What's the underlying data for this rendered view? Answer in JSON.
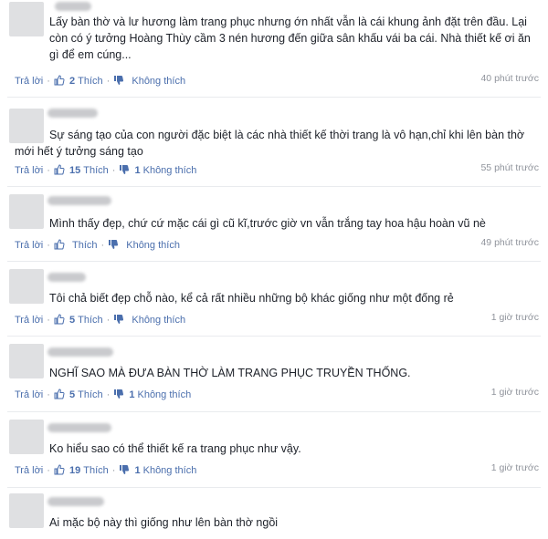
{
  "labels": {
    "reply": "Trả lời",
    "like": "Thích",
    "dislike": "Không thích",
    "separator": "·"
  },
  "colors": {
    "link": "#4b6fad",
    "text": "#1d2129",
    "muted": "#90949c",
    "avatar": "#dfe0e2"
  },
  "icons": {
    "like": "thumbs-up-icon",
    "dislike": "thumbs-down-icon"
  },
  "comments": [
    {
      "text": "Lấy bàn thờ và lư hương làm trang phục nhưng ớn nhất vẫn là cái khung ảnh đặt trên đầu. Lại còn có ý tưởng Hoàng Thùy cầm 3 nén hương đến giữa sân khấu vái ba cái. Nhà thiết kế ơi ăn gì để em cúng...",
      "likes": "2",
      "dislikes": "",
      "time": "40 phút trước"
    },
    {
      "text": "Sự sáng tạo của con người đặc biệt là các nhà thiết kế thời trang là vô hạn,chỉ khi lên bàn thờ mới hết ý tưởng sáng tạo",
      "likes": "15",
      "dislikes": "1",
      "time": "55 phút trước"
    },
    {
      "text": "Mình thấy đẹp, chứ cứ mặc cái gì cũ kĩ,trước giờ vn vẫn trắng tay hoa hậu hoàn vũ nè",
      "likes": "",
      "dislikes": "",
      "time": "49 phút trước"
    },
    {
      "text": "Tôi chả biết đẹp chỗ nào, kể cả rất nhiều những bộ khác giống như một đống rẻ",
      "likes": "5",
      "dislikes": "",
      "time": "1 giờ trước"
    },
    {
      "text": "NGHĨ SAO MÀ ĐƯA BÀN THỜ LÀM TRANG PHỤC TRUYỀN THỐNG.",
      "likes": "5",
      "dislikes": "1",
      "time": "1 giờ trước"
    },
    {
      "text": "Ko hiểu sao có thể thiết kế ra trang phục như vậy.",
      "likes": "19",
      "dislikes": "1",
      "time": "1 giờ trước"
    },
    {
      "text": "Ai mặc bộ này thì giống như lên bàn thờ ngồi",
      "likes": "",
      "dislikes": "",
      "time": ""
    }
  ]
}
